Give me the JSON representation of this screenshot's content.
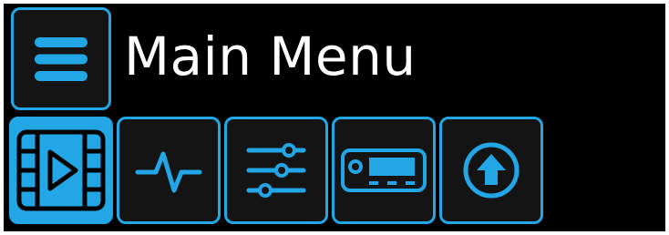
{
  "header": {
    "title": "Main Menu",
    "menu_icon": "hamburger-menu-icon"
  },
  "toolbar": {
    "items": [
      {
        "icon": "video-film-icon",
        "active": true
      },
      {
        "icon": "pulse-waveform-icon",
        "active": false
      },
      {
        "icon": "sliders-settings-icon",
        "active": false
      },
      {
        "icon": "device-receiver-icon",
        "active": false
      },
      {
        "icon": "upload-arrow-icon",
        "active": false
      }
    ]
  },
  "colors": {
    "accent": "#22a6e6",
    "background": "#000000",
    "tile_background": "#141414",
    "text": "#ffffff"
  }
}
